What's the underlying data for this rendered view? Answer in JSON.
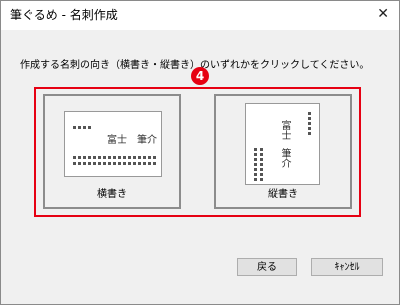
{
  "window": {
    "title": "筆ぐるめ - 名刺作成",
    "close_glyph": "✕"
  },
  "instruction": "作成する名刺の向き（横書き・縦書き）のいずれかをクリックしてください。",
  "step_badge": "4",
  "accent_color": "#e60012",
  "options": [
    {
      "label": "横書き",
      "sample_name": "富士　筆介"
    },
    {
      "label": "縦書き",
      "sample_surname": "富士",
      "sample_given": "筆介"
    }
  ],
  "buttons": {
    "back": "戻る",
    "cancel": "ｷｬﾝｾﾙ"
  }
}
